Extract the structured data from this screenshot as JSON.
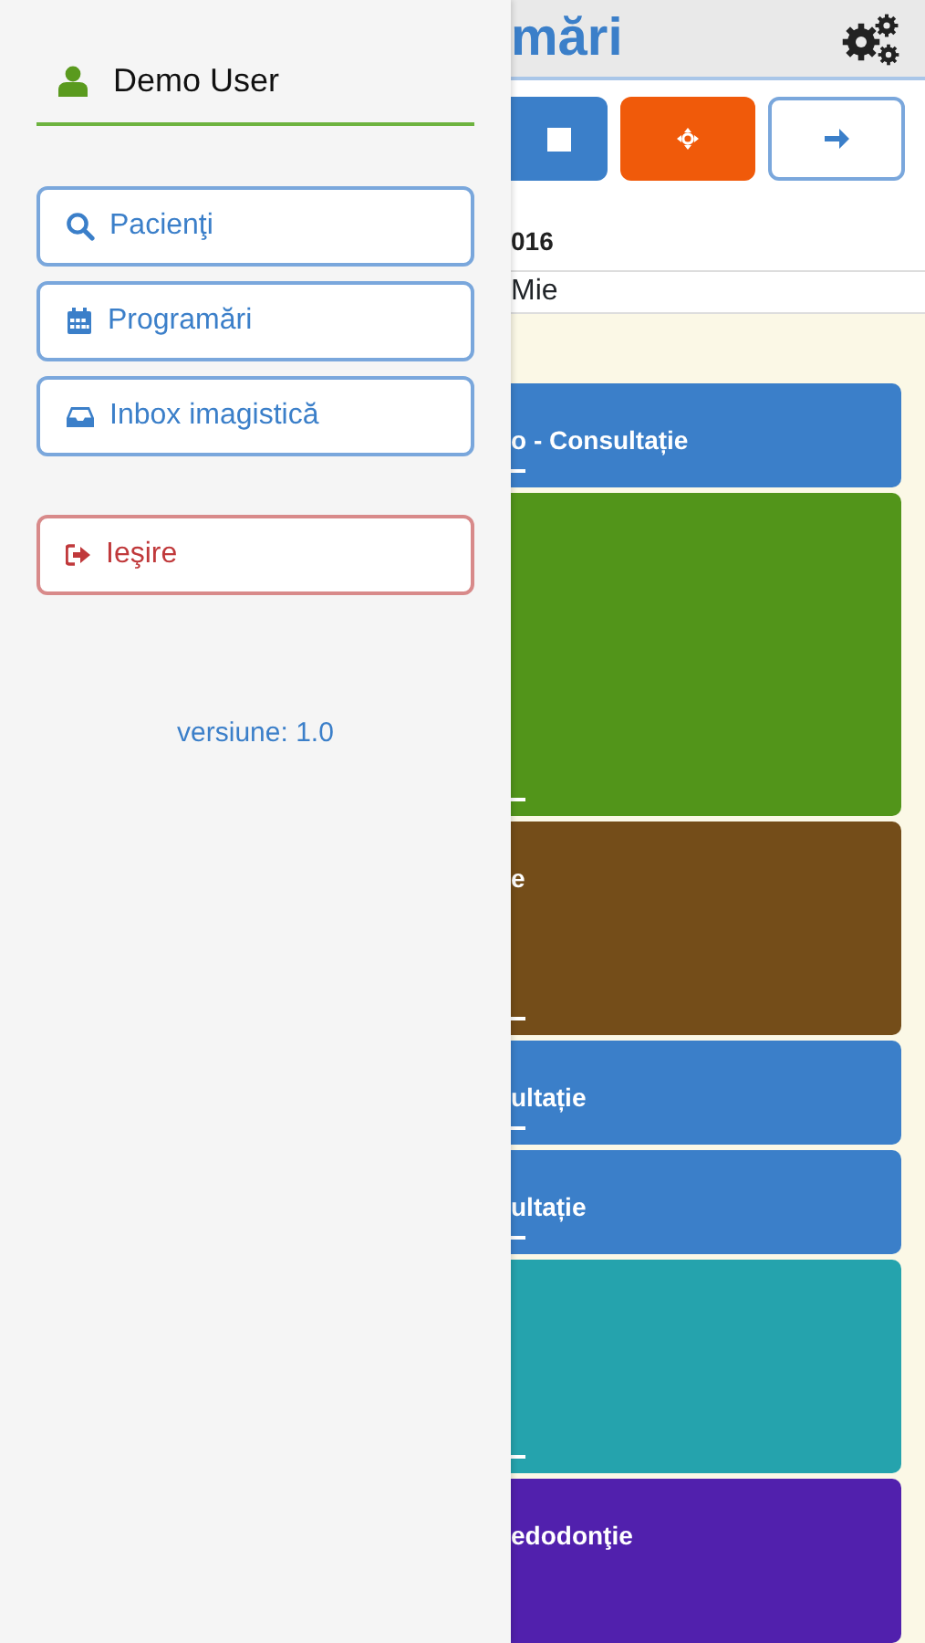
{
  "drawer": {
    "user": "Demo User",
    "menu": [
      {
        "label": "Pacienţi",
        "kind": "search"
      },
      {
        "label": "Programări",
        "kind": "calendar"
      },
      {
        "label": "Inbox imagistică",
        "kind": "inbox"
      }
    ],
    "logout": "Ieşire",
    "version": "versiune: 1.0"
  },
  "main": {
    "title": "mări",
    "toolbar": [
      {
        "kind": "stop"
      },
      {
        "kind": "target"
      },
      {
        "kind": "next"
      }
    ],
    "date": "016",
    "day": "Mie",
    "events": [
      {
        "text": "o - Consultație",
        "color": "#3b7fc9"
      },
      {
        "color": "#52951a"
      },
      {
        "text": "e",
        "color": "#744d19"
      },
      {
        "text": "ultație",
        "color": "#3b7fc9"
      },
      {
        "text": "ultație",
        "color": "#3b7fc9"
      },
      {
        "color": "#25a3ad"
      },
      {
        "text": "edodonţie",
        "color": "#5120ad"
      }
    ]
  }
}
